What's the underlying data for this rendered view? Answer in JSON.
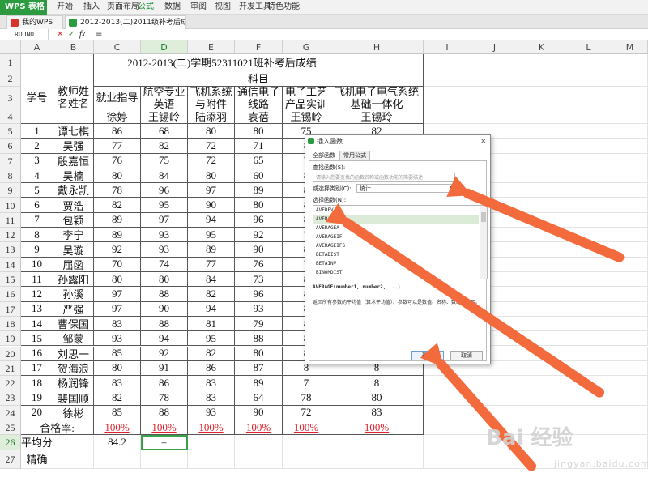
{
  "menubar": {
    "logo": "WPS 表格",
    "items": [
      "开始",
      "插入",
      "页面布局",
      "公式",
      "数据",
      "审阅",
      "视图",
      "开发工具",
      "特色功能"
    ],
    "active": "公式"
  },
  "tabs": [
    {
      "label": "我的WPS",
      "active": false
    },
    {
      "label": "2012-2013(二)2011级补考后成绩.xls *",
      "active": true
    }
  ],
  "formula_bar": {
    "name_box": "ROUND",
    "cancel_icon": "✕",
    "confirm_icon": "✓",
    "fx_label": "fx",
    "value": "="
  },
  "columns": [
    "A",
    "B",
    "C",
    "D",
    "E",
    "F",
    "G",
    "H",
    "I",
    "J",
    "K",
    "L",
    "M"
  ],
  "selected_column": "D",
  "row_numbers": [
    "1",
    "2",
    "3",
    "4",
    "5",
    "6",
    "7",
    "8",
    "9",
    "10",
    "11",
    "12",
    "13",
    "14",
    "15",
    "16",
    "17",
    "18",
    "19",
    "20",
    "21",
    "22",
    "23",
    "24",
    "25",
    "26",
    "27"
  ],
  "selected_row": "26",
  "sheet": {
    "title": "2012-2013(二)学期52311021班补考后成绩",
    "subject_header": "科目",
    "col_id": "学号",
    "col_teacher": "教师姓名姓名",
    "subjects": [
      "就业指导",
      "航空专业英语",
      "飞机系统与附件",
      "通信电子线路",
      "电子工艺产品实训",
      "飞机电子电气系统基础一体化"
    ],
    "teachers": [
      "徐婷",
      "王锡岭",
      "陆添羽",
      "袁蓓",
      "王锡岭",
      "王锡玲"
    ],
    "students": [
      {
        "id": "1",
        "name": "谭七棋",
        "scores": [
          "86",
          "68",
          "80",
          "80",
          "75",
          "82"
        ]
      },
      {
        "id": "2",
        "name": "吴强",
        "scores": [
          "77",
          "82",
          "72",
          "71",
          "8",
          "8"
        ]
      },
      {
        "id": "3",
        "name": "殷嘉恒",
        "scores": [
          "76",
          "75",
          "72",
          "65",
          "7",
          "8"
        ]
      },
      {
        "id": "4",
        "name": "吴楠",
        "scores": [
          "80",
          "84",
          "80",
          "60",
          "8",
          "8"
        ]
      },
      {
        "id": "5",
        "name": "戴永凯",
        "scores": [
          "78",
          "96",
          "97",
          "89",
          "8",
          "8"
        ]
      },
      {
        "id": "6",
        "name": "贾浩",
        "scores": [
          "82",
          "95",
          "90",
          "80",
          "8",
          "8"
        ]
      },
      {
        "id": "7",
        "name": "包颖",
        "scores": [
          "89",
          "97",
          "94",
          "96",
          "8",
          "8"
        ]
      },
      {
        "id": "8",
        "name": "李宁",
        "scores": [
          "89",
          "93",
          "95",
          "92",
          "7",
          "8"
        ]
      },
      {
        "id": "9",
        "name": "吴璇",
        "scores": [
          "92",
          "93",
          "89",
          "90",
          "8",
          "8"
        ]
      },
      {
        "id": "10",
        "name": "屈函",
        "scores": [
          "70",
          "74",
          "77",
          "76",
          "7",
          "8"
        ]
      },
      {
        "id": "11",
        "name": "孙露阳",
        "scores": [
          "80",
          "80",
          "84",
          "73",
          "8",
          "8"
        ]
      },
      {
        "id": "12",
        "name": "孙溪",
        "scores": [
          "97",
          "88",
          "82",
          "96",
          "8",
          "8"
        ]
      },
      {
        "id": "13",
        "name": "严强",
        "scores": [
          "97",
          "90",
          "94",
          "93",
          "8",
          "8"
        ]
      },
      {
        "id": "14",
        "name": "曹保国",
        "scores": [
          "83",
          "88",
          "81",
          "79",
          "8",
          "8"
        ]
      },
      {
        "id": "15",
        "name": "邹蒙",
        "scores": [
          "93",
          "94",
          "95",
          "88",
          "8",
          "8"
        ]
      },
      {
        "id": "16",
        "name": "刘思一",
        "scores": [
          "85",
          "92",
          "82",
          "80",
          "8",
          "8"
        ]
      },
      {
        "id": "17",
        "name": "贺海浪",
        "scores": [
          "80",
          "91",
          "86",
          "87",
          "8",
          "8"
        ]
      },
      {
        "id": "18",
        "name": "杨润锋",
        "scores": [
          "83",
          "86",
          "83",
          "89",
          "7",
          "8"
        ]
      },
      {
        "id": "19",
        "name": "裴国顺",
        "scores": [
          "82",
          "78",
          "83",
          "64",
          "78",
          "80"
        ]
      },
      {
        "id": "20",
        "name": "徐彬",
        "scores": [
          "85",
          "88",
          "93",
          "90",
          "72",
          "83"
        ]
      }
    ],
    "pass_label": "合格率:",
    "pass_rates": [
      "100%",
      "100%",
      "100%",
      "100%",
      "100%",
      "100%"
    ],
    "avg_label": "平均分",
    "avg_value": "84.2",
    "avg_formula": "=",
    "accuracy_label": "精确"
  },
  "dialog": {
    "title": "插入函数",
    "close": "×",
    "tabs": [
      "全部函数",
      "常用公式"
    ],
    "search_label": "查找函数(S):",
    "search_placeholder": "请输入您要查找的函数名称或函数功能的简要描述",
    "category_label": "或选择类别(C):",
    "category_value": "统计",
    "list_label": "选择函数(N):",
    "functions": [
      "AVEDEV",
      "AVERAGE",
      "AVERAGEA",
      "AVERAGEIF",
      "AVERAGEIFS",
      "BETADIST",
      "BETAINV",
      "BINOMDIST"
    ],
    "selected_function": "AVERAGE",
    "signature": "AVERAGE(number1, number2, ...)",
    "description": "返回所有参数的平均值（算术平均值）。参数可以是数值、名称、数组或引用。",
    "ok_label": "确定",
    "cancel_label": "取消"
  },
  "watermark": {
    "text": "Bai 经验",
    "sub": "jingyan.baidu.com"
  },
  "colors": {
    "accent": "#2c9a3f",
    "arrow": "#f36a3c",
    "pass_rate": "#e0202a"
  }
}
